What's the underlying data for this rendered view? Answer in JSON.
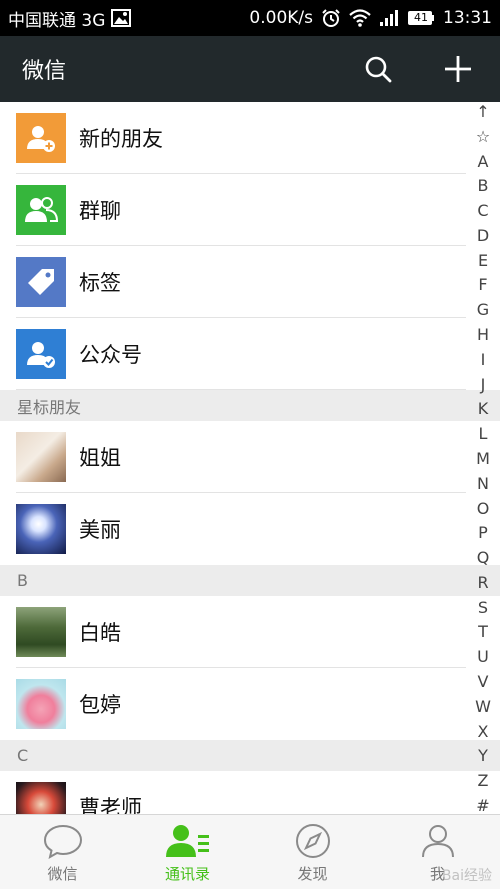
{
  "status_bar": {
    "carrier": "中国联通 3G",
    "speed": "0.00K/s",
    "battery": "41",
    "time": "13:31",
    "icons": [
      "image-icon",
      "alarm-icon",
      "wifi-icon",
      "signal-icon",
      "battery-icon"
    ]
  },
  "title_bar": {
    "title": "微信",
    "icons": [
      "search-icon",
      "plus-icon"
    ]
  },
  "contacts": {
    "functions": [
      {
        "label": "新的朋友",
        "icon": "add-friend-icon",
        "color": "#f29b38"
      },
      {
        "label": "群聊",
        "icon": "group-chat-icon",
        "color": "#36b63c"
      },
      {
        "label": "标签",
        "icon": "tag-icon",
        "color": "#5479c6"
      },
      {
        "label": "公众号",
        "icon": "official-account-icon",
        "color": "#2f7fd4"
      }
    ],
    "sections": [
      {
        "header": "星标朋友",
        "items": [
          {
            "name": "姐姐"
          },
          {
            "name": "美丽"
          }
        ]
      },
      {
        "header": "B",
        "items": [
          {
            "name": "白皓"
          },
          {
            "name": "包婷"
          }
        ]
      },
      {
        "header": "C",
        "items": [
          {
            "name": "曹老师"
          }
        ]
      }
    ]
  },
  "index_bar": [
    "↑",
    "☆",
    "A",
    "B",
    "C",
    "D",
    "E",
    "F",
    "G",
    "H",
    "I",
    "J",
    "K",
    "L",
    "M",
    "N",
    "O",
    "P",
    "Q",
    "R",
    "S",
    "T",
    "U",
    "V",
    "W",
    "X",
    "Y",
    "Z",
    "#"
  ],
  "tab_bar": {
    "tabs": [
      {
        "label": "微信",
        "icon": "chat-bubble-icon",
        "active": false
      },
      {
        "label": "通讯录",
        "icon": "contacts-icon",
        "active": true
      },
      {
        "label": "发现",
        "icon": "compass-icon",
        "active": false
      },
      {
        "label": "我",
        "icon": "person-icon",
        "active": false
      }
    ],
    "active_color": "#45c01a"
  },
  "watermark": "Bai经验"
}
